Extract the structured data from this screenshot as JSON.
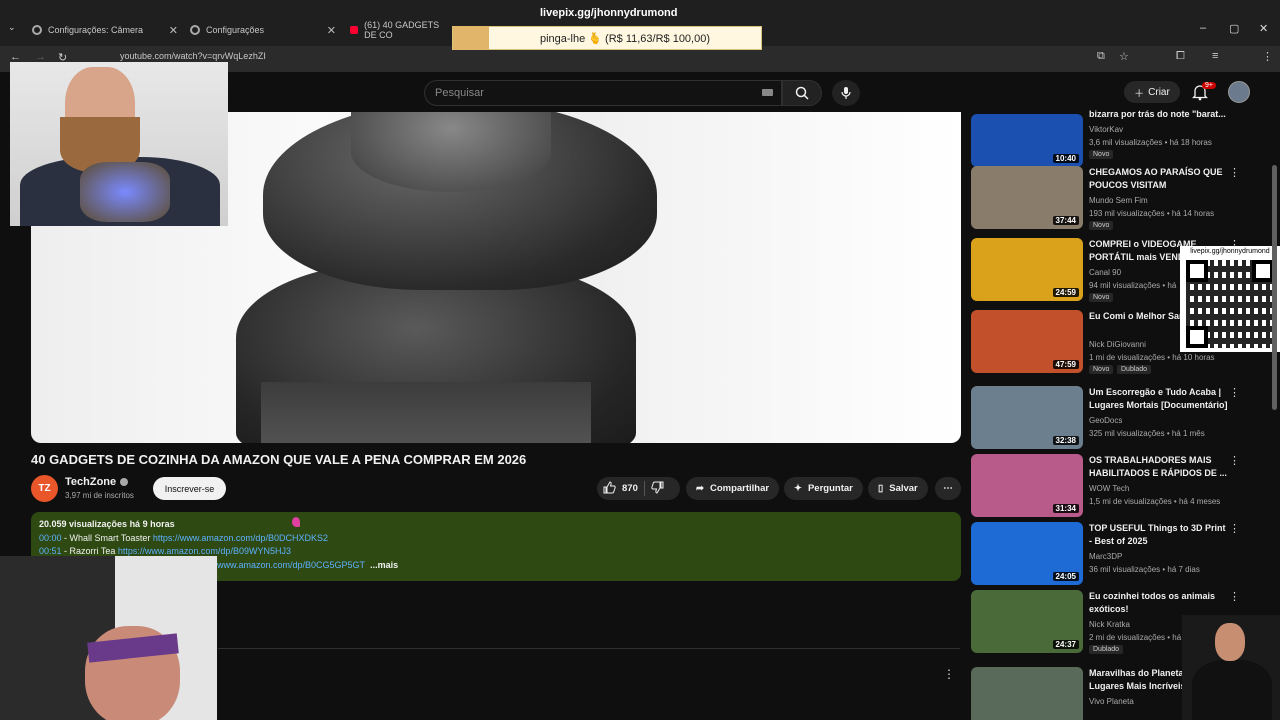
{
  "browser": {
    "tabs": [
      {
        "label": "Configurações: Câmera"
      },
      {
        "label": "Configurações"
      },
      {
        "label": "(61) 40 GADGETS DE CO"
      }
    ],
    "url": "youtube.com/watch?v=qrvWqLezhZI"
  },
  "overlay": {
    "livepix_url": "livepix.gg/jhonnydrumond",
    "donation_text": "pinga-lhe 🫰 (R$ 11,63/R$ 100,00)",
    "qr_label": "livepix.gg/jhonnydrumond"
  },
  "header": {
    "search_placeholder": "Pesquisar",
    "create_label": "Criar",
    "notification_count": "9+"
  },
  "video": {
    "title": "40 GADGETS DE COZINHA DA AMAZON QUE VALE A PENA COMPRAR EM 2026",
    "channel": "TechZone",
    "channel_logo_text": "TZ",
    "subscribers": "3,97 mi de inscritos",
    "subscribe_label": "Inscrever-se",
    "likes": "870",
    "share_label": "Compartilhar",
    "ask_label": "Perguntar",
    "save_label": "Salvar"
  },
  "description": {
    "views_line": "20.059 visualizações  há 9 horas",
    "lines": [
      {
        "ts": "00:00",
        "text": " - Whall Smart Toaster ",
        "link": "https://www.amazon.com/dp/B0DCHXDKS2"
      },
      {
        "ts": "00:51",
        "text": " - Razorri Tea ",
        "link": "https://www.amazon.com/dp/B09WYN5HJ3"
      },
      {
        "ts": "",
        "text": "",
        "link": "www.amazon.com/dp/B0CG5GP5GT"
      }
    ],
    "more_label": "...mais"
  },
  "sidebar": [
    {
      "title": "bizarra por trás do note \"barat...",
      "channel": "ViktorKav",
      "meta": "3,6 mil visualizações • há 18 horas",
      "badge": "Novo",
      "duration": "10:40"
    },
    {
      "title": "CHEGAMOS AO PARAÍSO QUE POUCOS VISITAM",
      "channel": "Mundo Sem Fim",
      "meta": "193 mil visualizações • há 14 horas",
      "badge": "Novo",
      "duration": "37:44"
    },
    {
      "title": "COMPREI o VIDEOGAME PORTÁTIL mais VEND",
      "channel": "Canal 90",
      "meta": "94 mil visualizações • há",
      "badge": "Novo",
      "duration": "24:59"
    },
    {
      "title": "Eu Comi o Melhor San MUNDO",
      "channel": "Nick DiGiovanni",
      "meta": "1 mi de visualizações • há 10 horas",
      "badge": "Novo",
      "badge2": "Dublado",
      "duration": "47:59"
    },
    {
      "title": "Um Escorregão e Tudo Acaba | Lugares Mortais [Documentário]",
      "channel": "GeoDocs",
      "meta": "325 mil visualizações • há 1 mês",
      "badge": "",
      "duration": "32:38"
    },
    {
      "title": "OS TRABALHADORES MAIS HABILITADOS E RÁPIDOS DE ...",
      "channel": "WOW Tech",
      "meta": "1,5 mi de visualizações • há 4 meses",
      "badge": "",
      "duration": "31:34"
    },
    {
      "title": "TOP USEFUL Things to 3D Print - Best of 2025",
      "channel": "Marc3DP",
      "meta": "36 mil visualizações • há 7 dias",
      "badge": "",
      "duration": "24:05"
    },
    {
      "title": "Eu cozinhei todos os animais exóticos!",
      "channel": "Nick Kratka",
      "meta": "2 mi de visualizações • há 9 dias",
      "badge": "",
      "badge2": "Dublado",
      "duration": "24:37"
    },
    {
      "title": "Maravilhas do Planeta | C Lugares Mais Incríveis",
      "channel": "Vivo Planeta",
      "meta": "",
      "badge": "",
      "duration": ""
    }
  ],
  "thumb_colors": [
    "#1b4fb0",
    "#8a7c6a",
    "#d9a21a",
    "#c2502a",
    "#6b7f8f",
    "#b85a8a",
    "#1e6bd6",
    "#4a6a3a",
    "#5a6a5a"
  ]
}
